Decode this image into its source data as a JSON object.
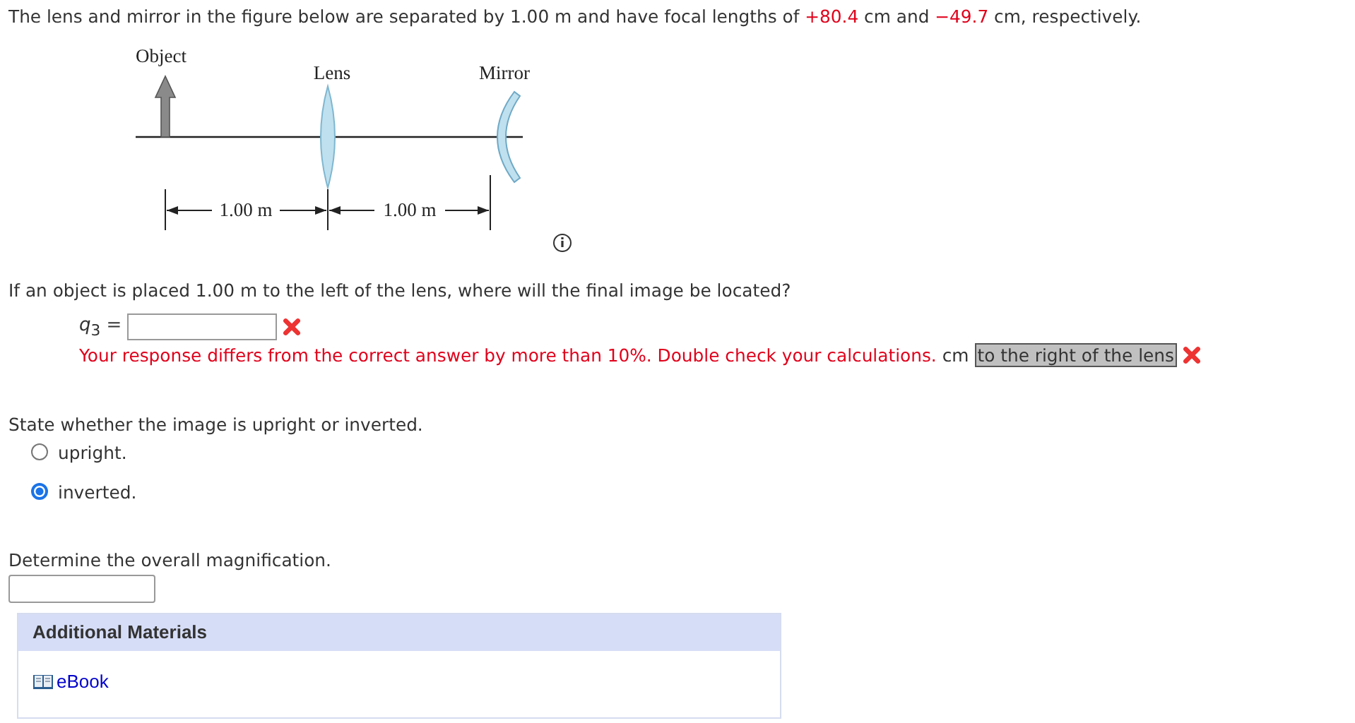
{
  "intro": [
    {
      "kind": "plain",
      "text": "The lens and mirror in the figure below are separated by 1.00 m and have focal lengths of "
    },
    {
      "kind": "value",
      "text": "+80.4"
    },
    {
      "kind": "plain",
      "text": " cm and "
    },
    {
      "kind": "value",
      "text": "−49.7"
    },
    {
      "kind": "plain",
      "text": " cm, respectively."
    }
  ],
  "figure": {
    "object_label": "Object",
    "lens_label": "Lens",
    "mirror_label": "Mirror",
    "distances": [
      "1.00 m",
      "1.00 m"
    ]
  },
  "question_1": {
    "prompt": "If an object is placed 1.00 m to the left of the lens, where will the final image be located?",
    "variable": "*q*$_{3}$ =",
    "correct": false,
    "feedback": "Your response differs from the correct answer by more than 10%. Double check your calculations.",
    "unit": "cm",
    "position_value": "to the right of the lens",
    "position_correct": false
  },
  "question_2": {
    "prompt": "State whether the image is upright or inverted.",
    "options": [
      {
        "label": "upright.",
        "selected": false
      },
      {
        "label": "inverted.",
        "selected": true
      }
    ]
  },
  "question_3": {
    "prompt": "Determine the overall magnification."
  },
  "additional_materials": {
    "title": "Additional Materials",
    "links": [
      "eBook"
    ]
  }
}
